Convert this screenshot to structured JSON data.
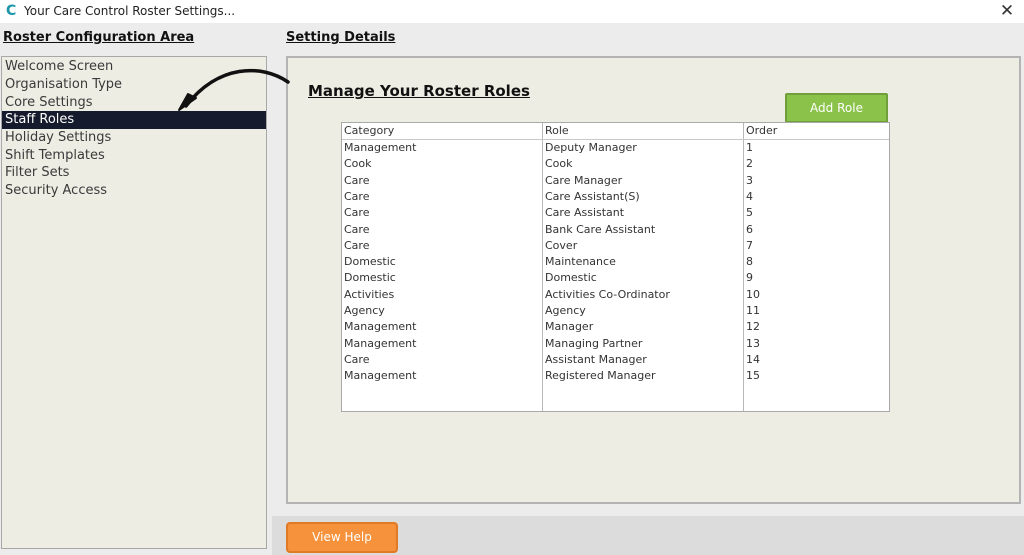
{
  "window": {
    "title": "Your Care Control Roster Settings...",
    "app_icon": "C",
    "close_glyph": "✕"
  },
  "sidebar": {
    "header": "Roster Configuration Area",
    "items": [
      {
        "label": "Welcome Screen",
        "selected": false
      },
      {
        "label": "Organisation Type",
        "selected": false
      },
      {
        "label": "Core Settings",
        "selected": false
      },
      {
        "label": "Staff Roles",
        "selected": true
      },
      {
        "label": "Holiday Settings",
        "selected": false
      },
      {
        "label": "Shift Templates",
        "selected": false
      },
      {
        "label": "Filter Sets",
        "selected": false
      },
      {
        "label": "Security Access",
        "selected": false
      }
    ]
  },
  "details": {
    "header": "Setting Details",
    "section_title": "Manage Your Roster Roles",
    "add_button": "Add Role",
    "table": {
      "columns": [
        "Category",
        "Role",
        "Order"
      ],
      "rows": [
        [
          "Management",
          "Deputy Manager",
          "1"
        ],
        [
          "Cook",
          "Cook",
          "2"
        ],
        [
          "Care",
          "Care Manager",
          "3"
        ],
        [
          "Care",
          "Care Assistant(S)",
          "4"
        ],
        [
          "Care",
          "Care Assistant",
          "5"
        ],
        [
          "Care",
          "Bank Care Assistant",
          "6"
        ],
        [
          "Care",
          "Cover",
          "7"
        ],
        [
          "Domestic",
          "Maintenance",
          "8"
        ],
        [
          "Domestic",
          "Domestic",
          "9"
        ],
        [
          "Activities",
          "Activities Co-Ordinator",
          "10"
        ],
        [
          "Agency",
          "Agency",
          "11"
        ],
        [
          "Management",
          "Manager",
          "12"
        ],
        [
          "Management",
          "Managing Partner",
          "13"
        ],
        [
          "Care",
          "Assistant Manager",
          "14"
        ],
        [
          "Management",
          "Registered Manager",
          "15"
        ]
      ]
    }
  },
  "footer": {
    "help_button": "View Help"
  },
  "colors": {
    "selected_bg": "#151b2c",
    "add_button": "#8bc34a",
    "help_button": "#f7923c",
    "app_icon": "#1c96a8"
  },
  "icons": {
    "app": "care-control-logo-icon",
    "close": "close-icon",
    "annotation": "curved-arrow-icon"
  }
}
